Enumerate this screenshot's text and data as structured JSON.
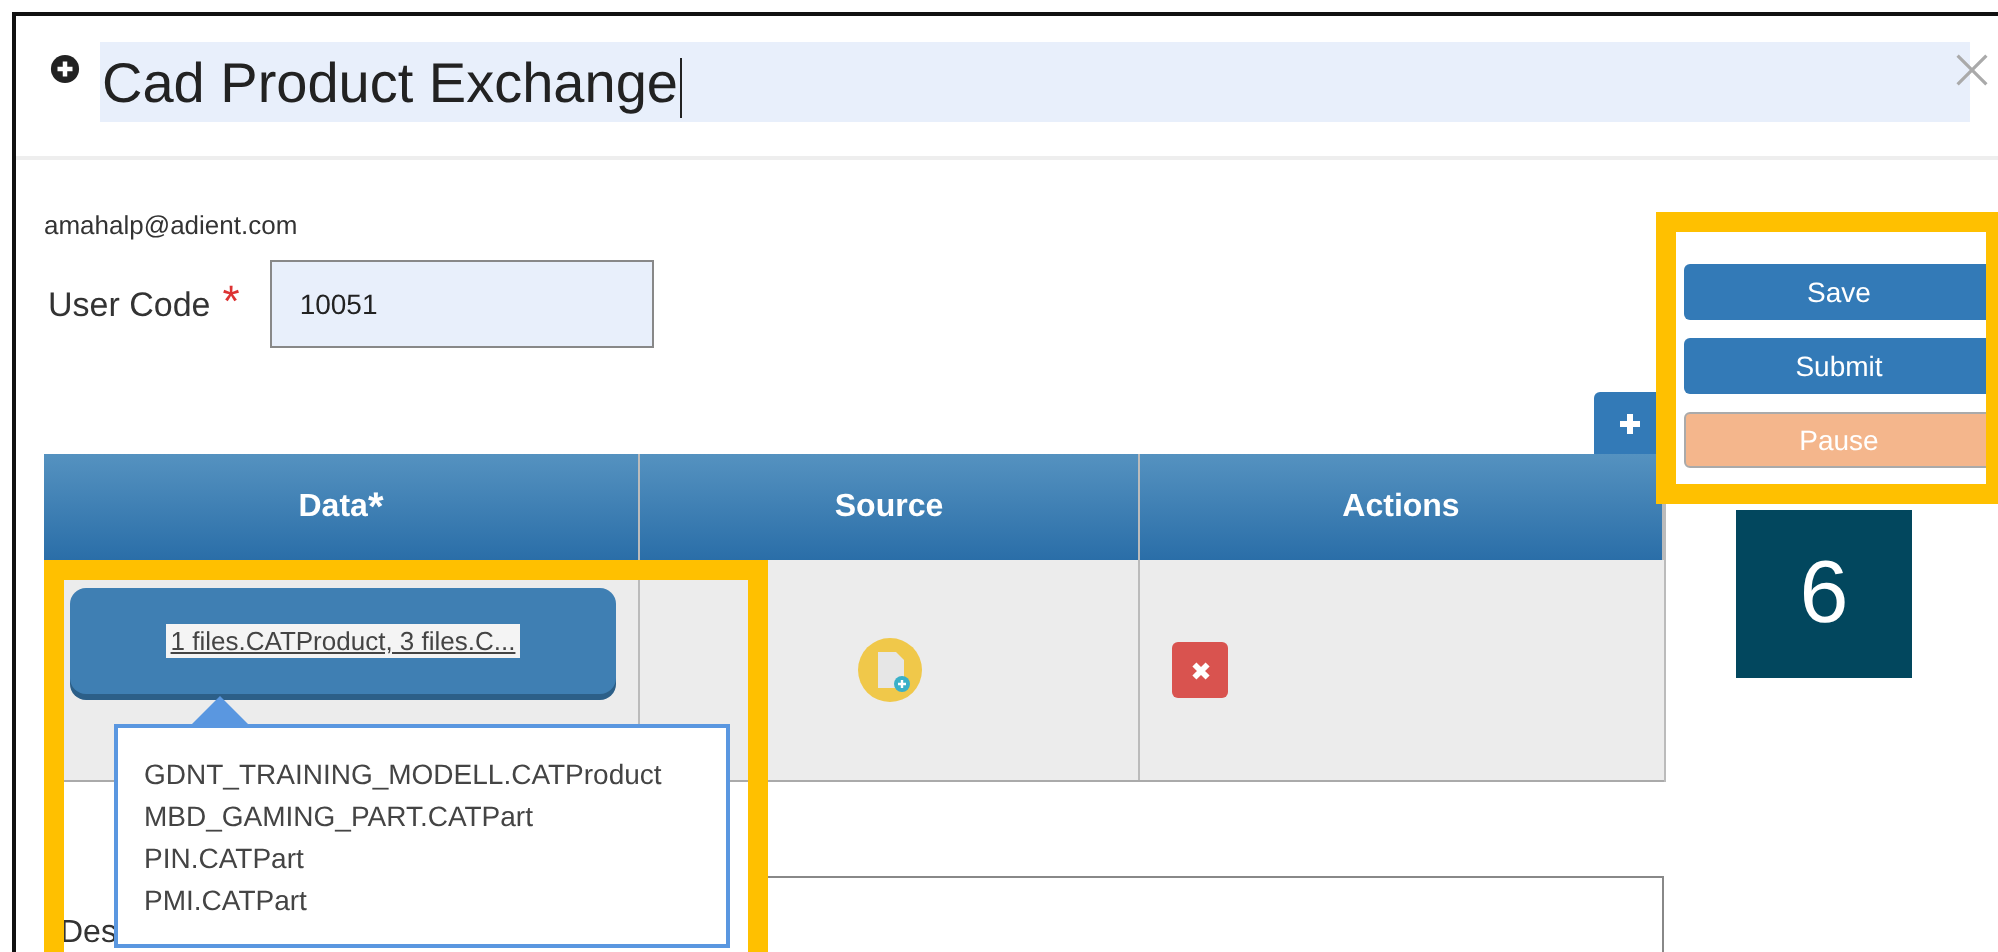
{
  "dialog": {
    "title": "Cad Product Exchange"
  },
  "user_email": "amahalp@adient.com",
  "user_code": {
    "label": "User Code",
    "required_mark": "*",
    "value": "10051"
  },
  "actions": [
    {
      "label": "Save",
      "kind": "primary"
    },
    {
      "label": "Submit",
      "kind": "primary"
    },
    {
      "label": "Pause",
      "kind": "warning"
    }
  ],
  "table": {
    "columns": [
      {
        "label": "Data",
        "required_mark": "*"
      },
      {
        "label": "Source"
      },
      {
        "label": "Actions"
      }
    ],
    "rows": [
      {
        "data": "1 files.CATProduct, 3 files.C..."
      }
    ]
  },
  "file_popup": {
    "files": [
      "GDNT_TRAINING_MODELL.CATProduct",
      "MBD_GAMING_PART.CATPart",
      "PIN.CATPart",
      "PMI.CATPart"
    ]
  },
  "description": {
    "label": "Des"
  },
  "callout": {
    "number": "6"
  }
}
